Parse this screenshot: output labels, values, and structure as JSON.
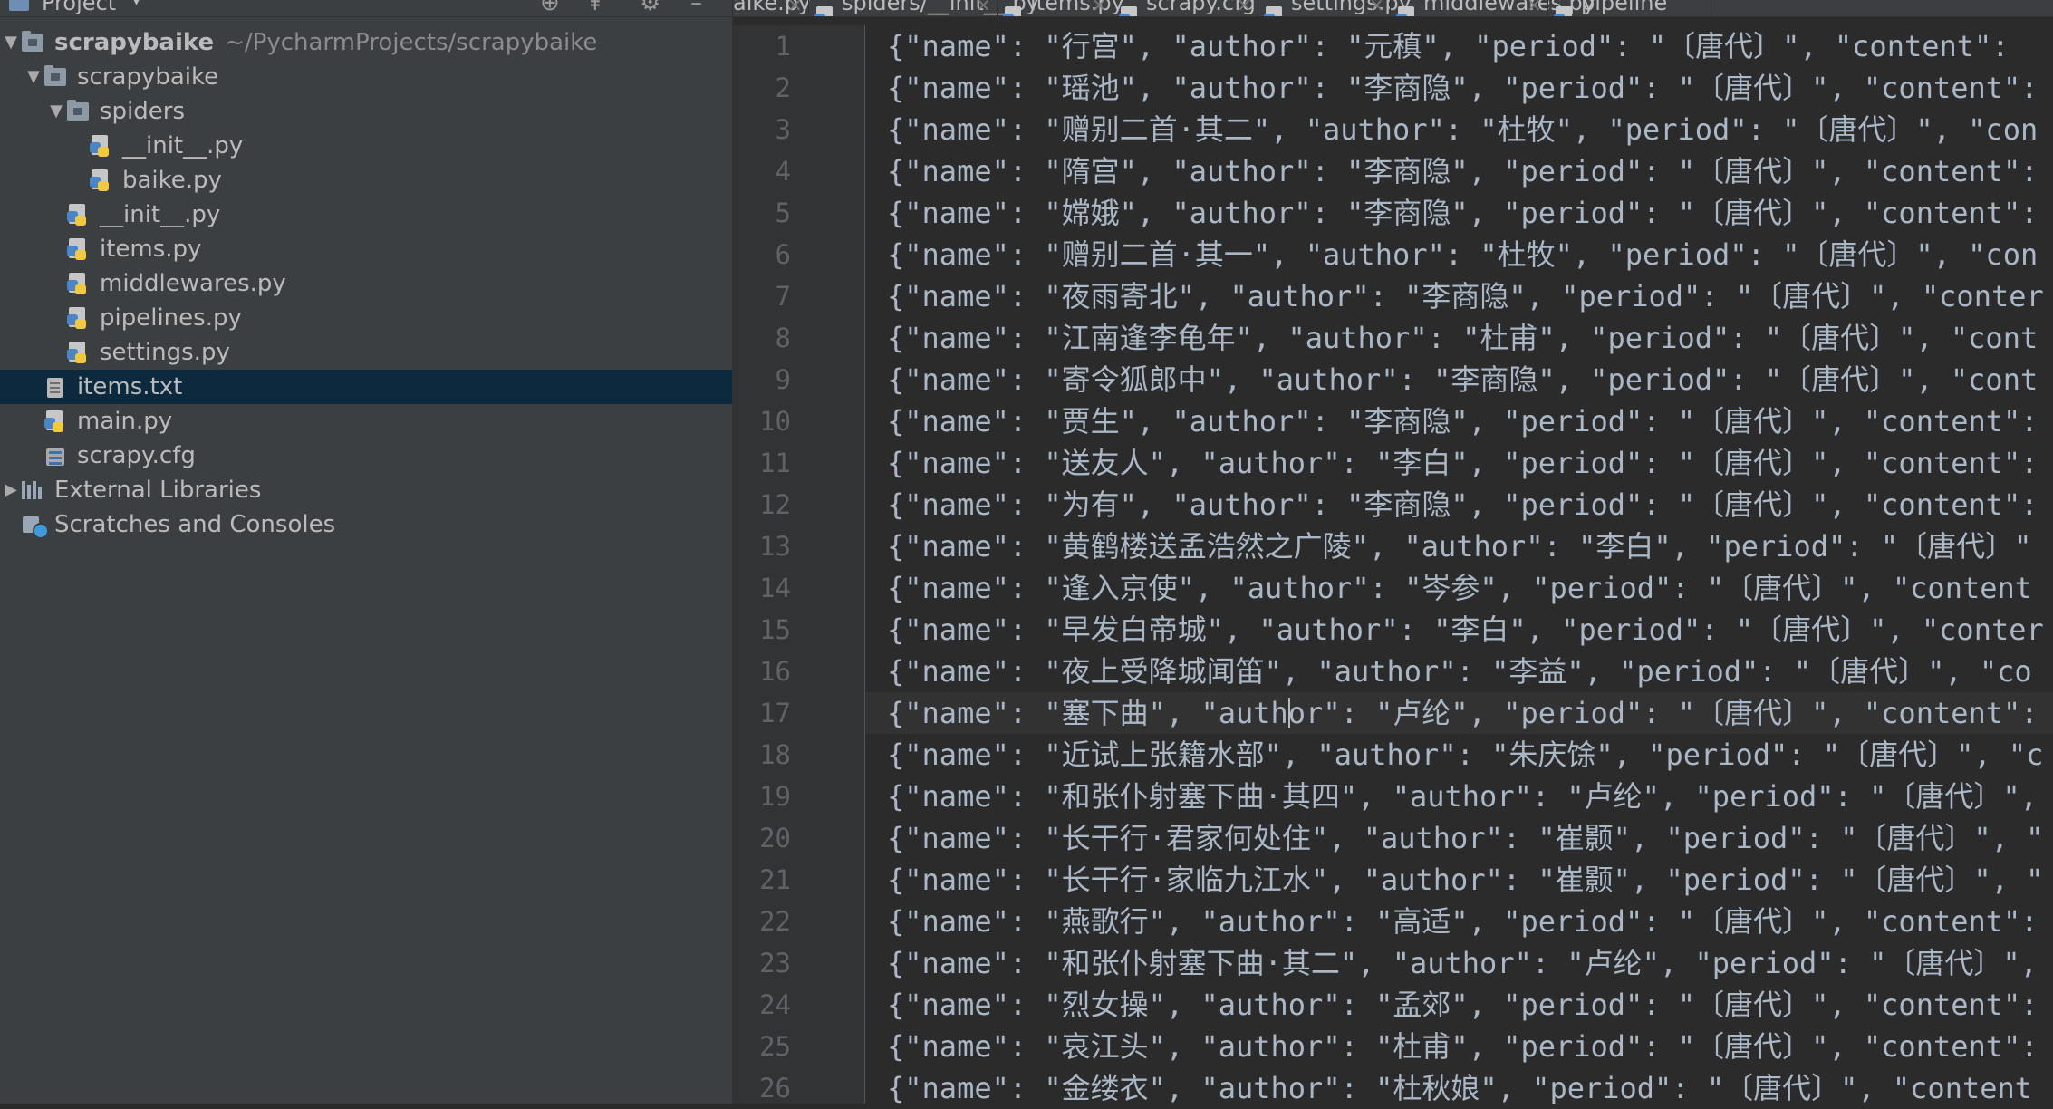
{
  "project_panel": {
    "title": "Project",
    "tree": [
      {
        "label": "scrapybaike",
        "path": "~/PycharmProjects/scrapybaike",
        "indent": 0,
        "arrow": "▼",
        "icon": "folder-icon",
        "kind": "folder",
        "bold": true
      },
      {
        "label": "scrapybaike",
        "indent": 1,
        "arrow": "▼",
        "icon": "folder-icon",
        "kind": "folder"
      },
      {
        "label": "spiders",
        "indent": 2,
        "arrow": "▼",
        "icon": "folder-icon",
        "kind": "folder"
      },
      {
        "label": "__init__.py",
        "indent": 3,
        "icon": "python-file-icon",
        "kind": "py"
      },
      {
        "label": "baike.py",
        "indent": 3,
        "icon": "python-file-icon",
        "kind": "py"
      },
      {
        "label": "__init__.py",
        "indent": 2,
        "icon": "python-file-icon",
        "kind": "py"
      },
      {
        "label": "items.py",
        "indent": 2,
        "icon": "python-file-icon",
        "kind": "py"
      },
      {
        "label": "middlewares.py",
        "indent": 2,
        "icon": "python-file-icon",
        "kind": "py"
      },
      {
        "label": "pipelines.py",
        "indent": 2,
        "icon": "python-file-icon",
        "kind": "py"
      },
      {
        "label": "settings.py",
        "indent": 2,
        "icon": "python-file-icon",
        "kind": "py"
      },
      {
        "label": "items.txt",
        "indent": 1,
        "icon": "text-file-icon",
        "kind": "txt",
        "selected": true
      },
      {
        "label": "main.py",
        "indent": 1,
        "icon": "python-file-icon",
        "kind": "py"
      },
      {
        "label": "scrapy.cfg",
        "indent": 1,
        "icon": "config-file-icon",
        "kind": "cfg"
      },
      {
        "label": "External Libraries",
        "indent": 0,
        "arrow": "▶",
        "icon": "library-icon",
        "kind": "libs"
      },
      {
        "label": "Scratches and Consoles",
        "indent": 0,
        "icon": "scratches-icon",
        "kind": "scratch"
      }
    ]
  },
  "editor": {
    "tabs": [
      {
        "label": "aike.py",
        "close": "×"
      },
      {
        "label": "spiders/__init__.py",
        "close": "×"
      },
      {
        "label": "items.py",
        "close": "×"
      },
      {
        "label": "scrapy.cfg",
        "close": "×"
      },
      {
        "label": "settings.py",
        "close": "×"
      },
      {
        "label": "middlewares.py",
        "close": "×"
      },
      {
        "label": "pipeline",
        "close": ""
      }
    ],
    "current_line": 17,
    "lines": [
      "{\"name\": \"行宫\", \"author\": \"元稹\", \"period\": \"〔唐代〕\", \"content\":",
      "{\"name\": \"瑶池\", \"author\": \"李商隐\", \"period\": \"〔唐代〕\", \"content\":",
      "{\"name\": \"赠别二首·其二\", \"author\": \"杜牧\", \"period\": \"〔唐代〕\", \"con",
      "{\"name\": \"隋宫\", \"author\": \"李商隐\", \"period\": \"〔唐代〕\", \"content\":",
      "{\"name\": \"嫦娥\", \"author\": \"李商隐\", \"period\": \"〔唐代〕\", \"content\":",
      "{\"name\": \"赠别二首·其一\", \"author\": \"杜牧\", \"period\": \"〔唐代〕\", \"con",
      "{\"name\": \"夜雨寄北\", \"author\": \"李商隐\", \"period\": \"〔唐代〕\", \"conter",
      "{\"name\": \"江南逢李龟年\", \"author\": \"杜甫\", \"period\": \"〔唐代〕\", \"cont",
      "{\"name\": \"寄令狐郎中\", \"author\": \"李商隐\", \"period\": \"〔唐代〕\", \"cont",
      "{\"name\": \"贾生\", \"author\": \"李商隐\", \"period\": \"〔唐代〕\", \"content\":",
      "{\"name\": \"送友人\", \"author\": \"李白\", \"period\": \"〔唐代〕\", \"content\":",
      "{\"name\": \"为有\", \"author\": \"李商隐\", \"period\": \"〔唐代〕\", \"content\":",
      "{\"name\": \"黄鹤楼送孟浩然之广陵\", \"author\": \"李白\", \"period\": \"〔唐代〕\"",
      "{\"name\": \"逢入京使\", \"author\": \"岑参\", \"period\": \"〔唐代〕\", \"content",
      "{\"name\": \"早发白帝城\", \"author\": \"李白\", \"period\": \"〔唐代〕\", \"conter",
      "{\"name\": \"夜上受降城闻笛\", \"author\": \"李益\", \"period\": \"〔唐代〕\", \"co",
      "{\"name\": \"塞下曲\", \"author\": \"卢纶\", \"period\": \"〔唐代〕\", \"content\":",
      "{\"name\": \"近试上张籍水部\", \"author\": \"朱庆馀\", \"period\": \"〔唐代〕\", \"c",
      "{\"name\": \"和张仆射塞下曲·其四\", \"author\": \"卢纶\", \"period\": \"〔唐代〕\",",
      "{\"name\": \"长干行·君家何处住\", \"author\": \"崔颢\", \"period\": \"〔唐代〕\", \"",
      "{\"name\": \"长干行·家临九江水\", \"author\": \"崔颢\", \"period\": \"〔唐代〕\", \"",
      "{\"name\": \"燕歌行\", \"author\": \"高适\", \"period\": \"〔唐代〕\", \"content\":",
      "{\"name\": \"和张仆射塞下曲·其二\", \"author\": \"卢纶\", \"period\": \"〔唐代〕\",",
      "{\"name\": \"烈女操\", \"author\": \"孟郊\", \"period\": \"〔唐代〕\", \"content\":",
      "{\"name\": \"哀江头\", \"author\": \"杜甫\", \"period\": \"〔唐代〕\", \"content\":",
      "{\"name\": \"金缕衣\", \"author\": \"杜秋娘\", \"period\": \"〔唐代〕\", \"content"
    ]
  }
}
